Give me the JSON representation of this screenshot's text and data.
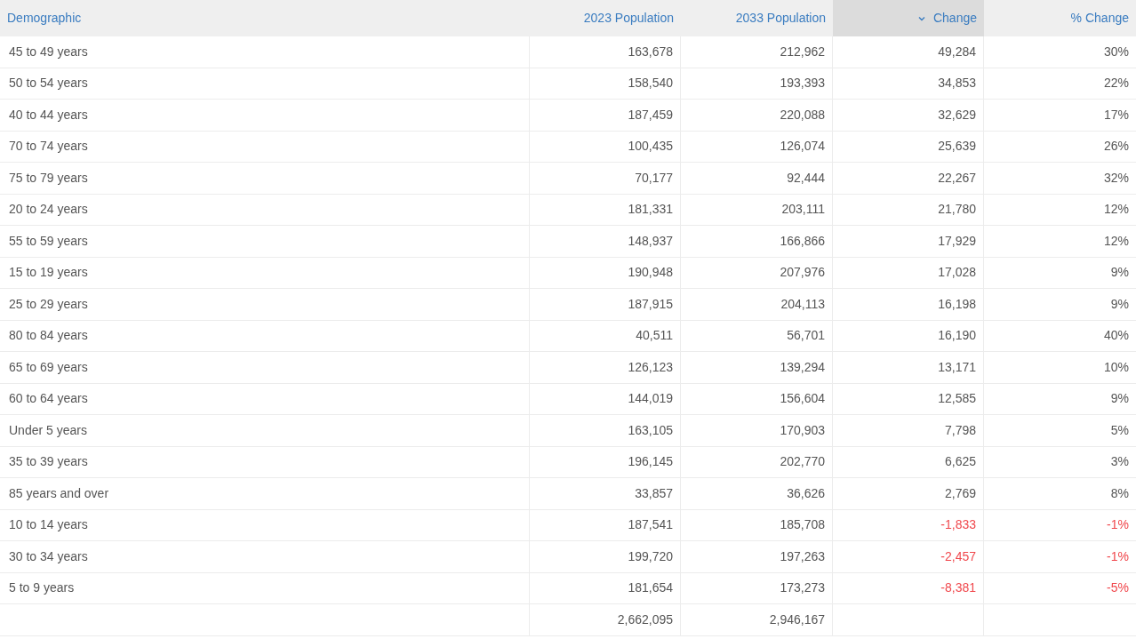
{
  "table": {
    "columns": [
      {
        "label": "Demographic",
        "sorted": false
      },
      {
        "label": "2023 Population",
        "sorted": false
      },
      {
        "label": "2033 Population",
        "sorted": false
      },
      {
        "label": "Change",
        "sorted": true
      },
      {
        "label": "% Change",
        "sorted": false
      }
    ],
    "rows": [
      {
        "cells": [
          "45 to 49 years",
          "163,678",
          "212,962",
          "49,284",
          "30%"
        ],
        "negative": false
      },
      {
        "cells": [
          "50 to 54 years",
          "158,540",
          "193,393",
          "34,853",
          "22%"
        ],
        "negative": false
      },
      {
        "cells": [
          "40 to 44 years",
          "187,459",
          "220,088",
          "32,629",
          "17%"
        ],
        "negative": false
      },
      {
        "cells": [
          "70 to 74 years",
          "100,435",
          "126,074",
          "25,639",
          "26%"
        ],
        "negative": false
      },
      {
        "cells": [
          "75 to 79 years",
          "70,177",
          "92,444",
          "22,267",
          "32%"
        ],
        "negative": false
      },
      {
        "cells": [
          "20 to 24 years",
          "181,331",
          "203,111",
          "21,780",
          "12%"
        ],
        "negative": false
      },
      {
        "cells": [
          "55 to 59 years",
          "148,937",
          "166,866",
          "17,929",
          "12%"
        ],
        "negative": false
      },
      {
        "cells": [
          "15 to 19 years",
          "190,948",
          "207,976",
          "17,028",
          "9%"
        ],
        "negative": false
      },
      {
        "cells": [
          "25 to 29 years",
          "187,915",
          "204,113",
          "16,198",
          "9%"
        ],
        "negative": false
      },
      {
        "cells": [
          "80 to 84 years",
          "40,511",
          "56,701",
          "16,190",
          "40%"
        ],
        "negative": false
      },
      {
        "cells": [
          "65 to 69 years",
          "126,123",
          "139,294",
          "13,171",
          "10%"
        ],
        "negative": false
      },
      {
        "cells": [
          "60 to 64 years",
          "144,019",
          "156,604",
          "12,585",
          "9%"
        ],
        "negative": false
      },
      {
        "cells": [
          "Under 5 years",
          "163,105",
          "170,903",
          "7,798",
          "5%"
        ],
        "negative": false
      },
      {
        "cells": [
          "35 to 39 years",
          "196,145",
          "202,770",
          "6,625",
          "3%"
        ],
        "negative": false
      },
      {
        "cells": [
          "85 years and over",
          "33,857",
          "36,626",
          "2,769",
          "8%"
        ],
        "negative": false
      },
      {
        "cells": [
          "10 to 14 years",
          "187,541",
          "185,708",
          "-1,833",
          "-1%"
        ],
        "negative": true
      },
      {
        "cells": [
          "30 to 34 years",
          "199,720",
          "197,263",
          "-2,457",
          "-1%"
        ],
        "negative": true
      },
      {
        "cells": [
          "5 to 9 years",
          "181,654",
          "173,273",
          "-8,381",
          "-5%"
        ],
        "negative": true
      }
    ],
    "totals": [
      "2,662,095",
      "2,946,167"
    ]
  }
}
